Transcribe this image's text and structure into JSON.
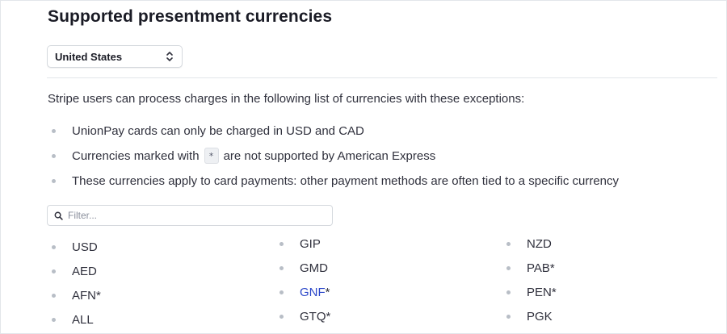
{
  "page": {
    "title": "Supported presentment currencies",
    "country_select": {
      "value": "United States"
    },
    "intro": "Stripe users can process charges in the following list of currencies with these exceptions:",
    "exceptions": {
      "item1": "UnionPay cards can only be charged in USD and CAD",
      "item2_before": "Currencies marked with",
      "item2_badge": "*",
      "item2_after": "are not supported by American Express",
      "item3": "These currencies apply to card payments: other payment methods are often tied to a specific currency"
    },
    "filter": {
      "placeholder": "Filter..."
    },
    "currencies": {
      "col1": [
        "USD",
        "AED",
        "AFN*",
        "ALL"
      ],
      "col2": [
        "GIP",
        "GMD",
        "GNF",
        "GTQ*"
      ],
      "col2_gnf_suffix": "*",
      "col3": [
        "NZD",
        "PAB*",
        "PEN*",
        "PGK"
      ]
    },
    "colors": {
      "link": "#2b47c9",
      "text": "#30313d",
      "title": "#1a1b25"
    }
  }
}
